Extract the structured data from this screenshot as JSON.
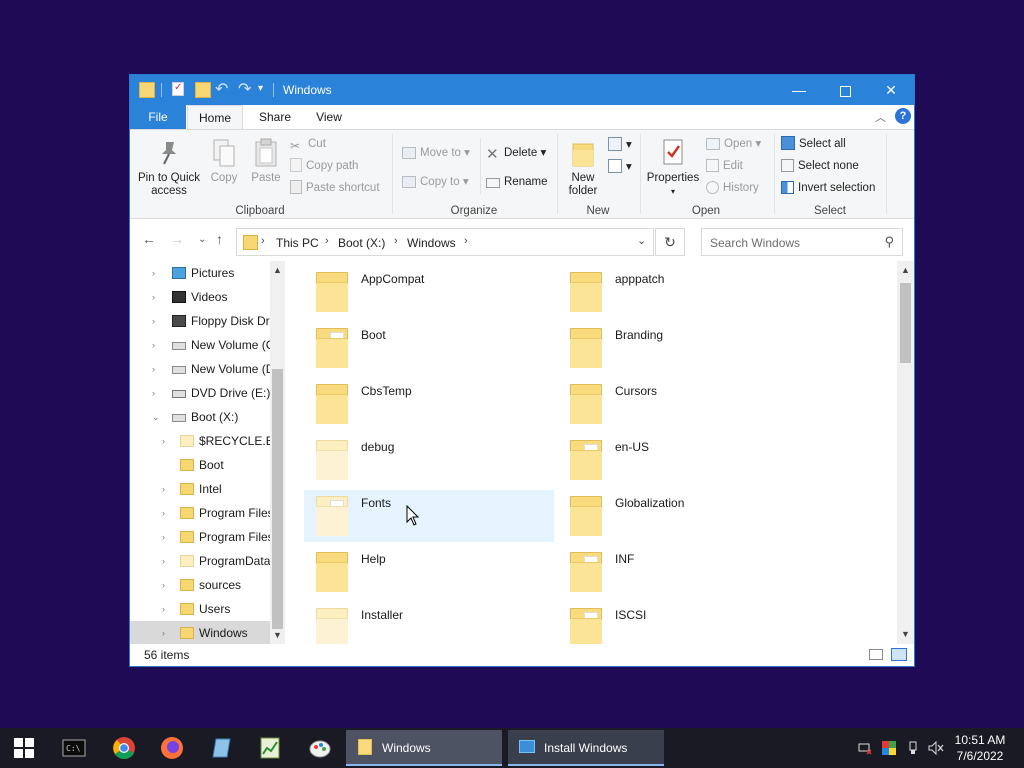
{
  "window": {
    "title": "Windows",
    "controls": {
      "minimize": "—",
      "maximize": "",
      "close": "✕"
    }
  },
  "ribbon_tabs": {
    "file": "File",
    "home": "Home",
    "share": "Share",
    "view": "View",
    "collapse": "︿",
    "help": "?"
  },
  "ribbon": {
    "clipboard": {
      "label": "Clipboard",
      "pin": "Pin to Quick access",
      "copy": "Copy",
      "paste": "Paste",
      "cut": "Cut",
      "copy_path": "Copy path",
      "paste_shortcut": "Paste shortcut"
    },
    "organize": {
      "label": "Organize",
      "move_to": "Move to",
      "copy_to": "Copy to",
      "delete": "Delete",
      "rename": "Rename"
    },
    "new": {
      "label": "New",
      "new_folder": "New folder"
    },
    "open": {
      "label": "Open",
      "properties": "Properties",
      "open": "Open",
      "edit": "Edit",
      "history": "History"
    },
    "select": {
      "label": "Select",
      "select_all": "Select all",
      "select_none": "Select none",
      "invert": "Invert selection"
    }
  },
  "address": {
    "crumbs": [
      "This PC",
      "Boot (X:)",
      "Windows"
    ],
    "search_placeholder": "Search Windows"
  },
  "nav_pane": {
    "items": [
      {
        "label": "Pictures",
        "icon": "pictures-icon"
      },
      {
        "label": "Videos",
        "icon": "videos-icon"
      },
      {
        "label": "Floppy Disk Dri",
        "icon": "floppy-icon"
      },
      {
        "label": "New Volume (C",
        "icon": "drive-icon"
      },
      {
        "label": "New Volume (D",
        "icon": "drive-icon"
      },
      {
        "label": "DVD Drive (E:) I",
        "icon": "dvd-icon"
      },
      {
        "label": "Boot (X:)",
        "icon": "drive-icon"
      },
      {
        "label": "$RECYCLE.BIN",
        "icon": "folder-icon"
      },
      {
        "label": "Boot",
        "icon": "folder-icon"
      },
      {
        "label": "Intel",
        "icon": "folder-icon"
      },
      {
        "label": "Program Files",
        "icon": "folder-icon"
      },
      {
        "label": "Program Files",
        "icon": "folder-icon"
      },
      {
        "label": "ProgramData",
        "icon": "folder-icon"
      },
      {
        "label": "sources",
        "icon": "folder-icon"
      },
      {
        "label": "Users",
        "icon": "folder-icon"
      },
      {
        "label": "Windows",
        "icon": "folder-icon"
      }
    ]
  },
  "folders": [
    {
      "name": "AppCompat"
    },
    {
      "name": "apppatch"
    },
    {
      "name": "Boot"
    },
    {
      "name": "Branding"
    },
    {
      "name": "CbsTemp"
    },
    {
      "name": "Cursors"
    },
    {
      "name": "debug"
    },
    {
      "name": "en-US"
    },
    {
      "name": "Fonts"
    },
    {
      "name": "Globalization"
    },
    {
      "name": "Help"
    },
    {
      "name": "INF"
    },
    {
      "name": "Installer"
    },
    {
      "name": "ISCSI"
    }
  ],
  "status": {
    "item_count": "56 items"
  },
  "taskbar": {
    "apps": [
      {
        "label": "Windows"
      },
      {
        "label": "Install Windows"
      }
    ],
    "clock": {
      "time": "10:51 AM",
      "date": "7/6/2022"
    }
  },
  "colors": {
    "desktop": "#1f0a55",
    "titlebar": "#2b82d9",
    "folder": "#f8db7e",
    "selection": "#e5f3ff",
    "taskbar": "#191a24"
  }
}
